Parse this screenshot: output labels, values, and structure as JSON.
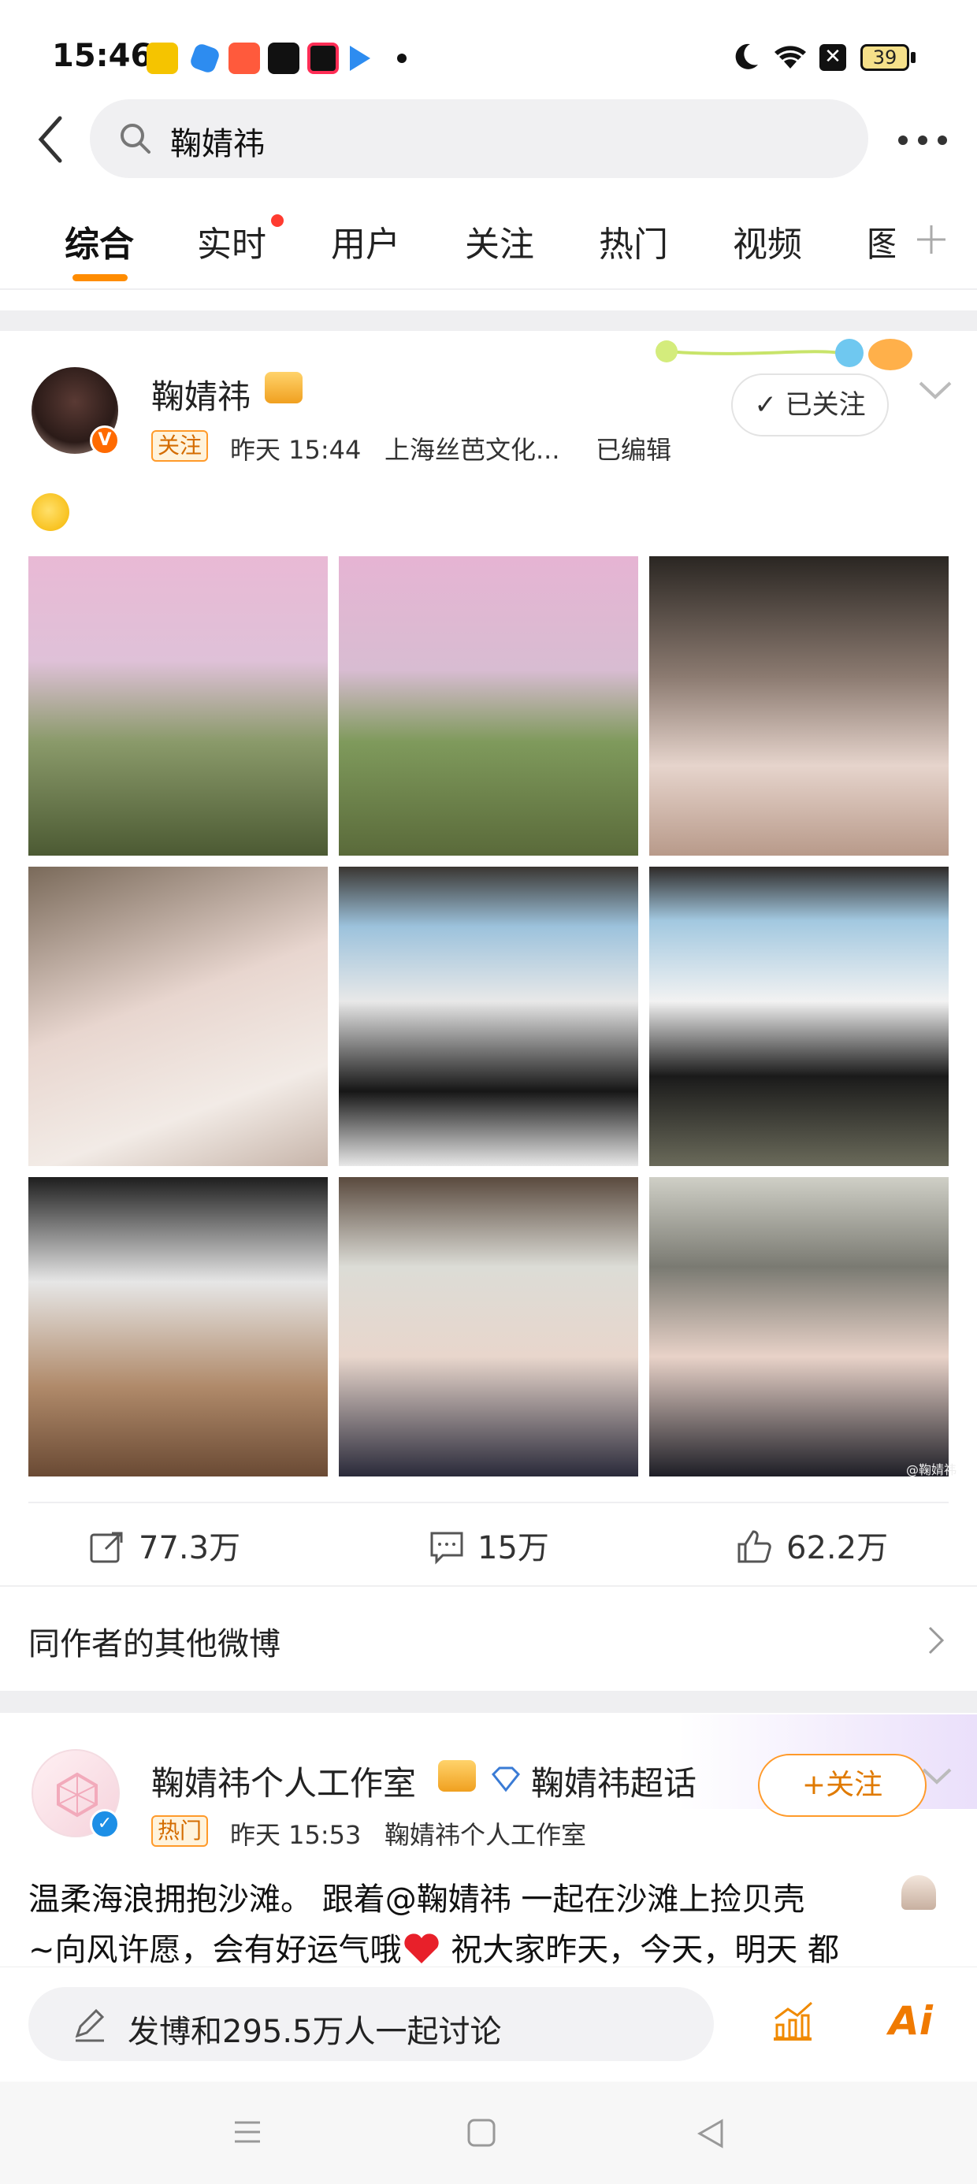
{
  "status_bar": {
    "time": "15:46",
    "battery": "39",
    "app_icons": [
      "weibo-icon",
      "feather-icon",
      "app-grid-icon",
      "capcut-icon",
      "record-icon",
      "play-icon"
    ]
  },
  "search": {
    "query": "鞠婧祎"
  },
  "tabs": [
    {
      "label": "综合",
      "active": true
    },
    {
      "label": "实时",
      "badge": true
    },
    {
      "label": "用户"
    },
    {
      "label": "关注"
    },
    {
      "label": "热门"
    },
    {
      "label": "视频"
    },
    {
      "label": "图"
    }
  ],
  "post1": {
    "author": "鞠婧祎",
    "tag": "关注",
    "time": "昨天 15:44",
    "source": "上海丝芭文化...",
    "edited": "已编辑",
    "follow_label": "已关注",
    "verified": "V",
    "photos": [
      {
        "desc": "sunset-tree-1"
      },
      {
        "desc": "sunset-tree-2"
      },
      {
        "desc": "beach-portrait"
      },
      {
        "desc": "white-dress-selfie"
      },
      {
        "desc": "panda-cap-1"
      },
      {
        "desc": "panda-cap-2"
      },
      {
        "desc": "panda-cap-3"
      },
      {
        "desc": "floral-hat-1"
      },
      {
        "desc": "floral-hat-2"
      }
    ],
    "watermark": "@鞠婧祎",
    "reposts": "77.3万",
    "comments": "15万",
    "likes": "62.2万"
  },
  "other_posts_label": "同作者的其他微博",
  "post2": {
    "author": "鞠婧祎个人工作室",
    "supertopic": "鞠婧祎超话",
    "tag": "热门",
    "time": "昨天 15:53",
    "source": "鞠婧祎个人工作室",
    "follow_label": "关注",
    "follow_plus": "+",
    "body_line1": "温柔海浪拥抱沙滩。 跟着@鞠婧祎 一起在沙滩上捡贝壳",
    "body_line2": "~向风许愿，会有好运气哦",
    "body_line2b": " 祝大家昨天，今天，明天 都"
  },
  "compose": {
    "placeholder": "发博和295.5万人一起讨论",
    "ai_label": "Ai"
  },
  "colors": {
    "accent": "#ff8c00",
    "badge_red": "#ff3b30",
    "verified_orange": "#ff6a00",
    "verified_blue": "#1d8fe6"
  }
}
